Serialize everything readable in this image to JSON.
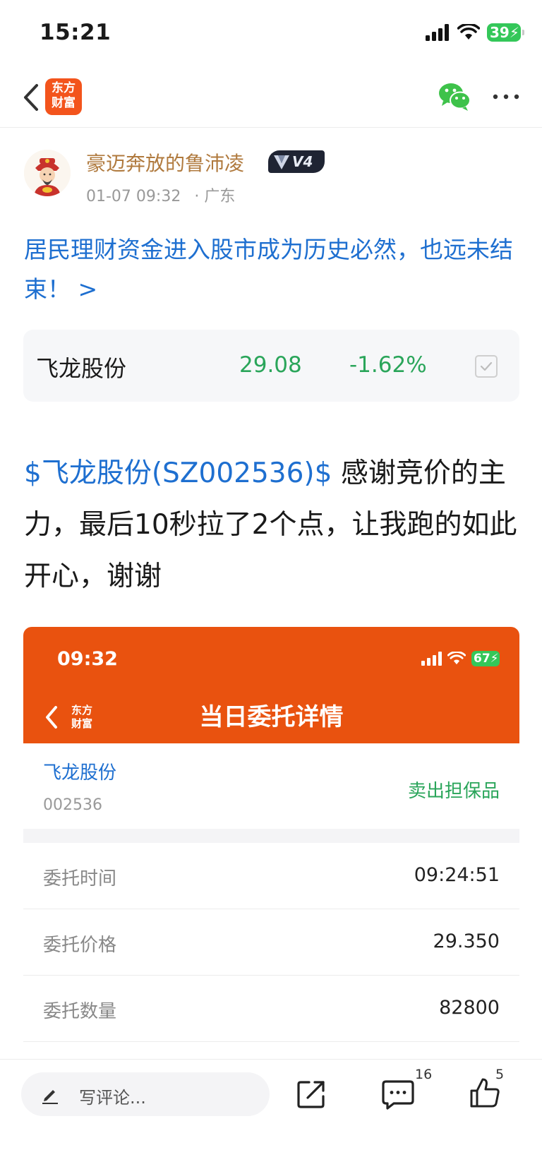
{
  "status_bar": {
    "time": "15:21",
    "battery": "39"
  },
  "nav": {
    "logo_line1": "东方",
    "logo_line2": "财富"
  },
  "author": {
    "name": "豪迈奔放的鲁沛凌",
    "level": "V4",
    "datetime": "01-07 09:32",
    "location": "· 广东"
  },
  "headline": "居民理财资金进入股市成为历史必然，也远未结束！ >",
  "stock_card": {
    "name": "飞龙股份",
    "price": "29.08",
    "change": "-1.62%"
  },
  "post_body": {
    "tag": "$飞龙股份(SZ002536)$",
    "text": "  感谢竞价的主力，最后10秒拉了2个点，让我跑的如此开心，谢谢"
  },
  "embedded_screenshot": {
    "time": "09:32",
    "battery": "67",
    "logo_line1": "东方",
    "logo_line2": "财富",
    "title": "当日委托详情",
    "stock_name": "飞龙股份",
    "stock_code": "002536",
    "order_type": "卖出担保品",
    "rows": [
      {
        "label": "委托时间",
        "value": "09:24:51"
      },
      {
        "label": "委托价格",
        "value": "29.350"
      },
      {
        "label": "委托数量",
        "value": "82800"
      }
    ]
  },
  "bottom_bar": {
    "comment_placeholder": "写评论...",
    "comment_count": "16",
    "like_count": "5"
  },
  "colors": {
    "brand_orange": "#e9520f",
    "link_blue": "#1e6fd0",
    "down_green": "#2aa55a",
    "author_gold": "#b07a3e"
  },
  "icons": [
    "back-icon",
    "wechat-icon",
    "more-icon",
    "check-icon",
    "pen-icon",
    "share-icon",
    "comment-icon",
    "like-icon",
    "signal-icon",
    "wifi-icon"
  ]
}
